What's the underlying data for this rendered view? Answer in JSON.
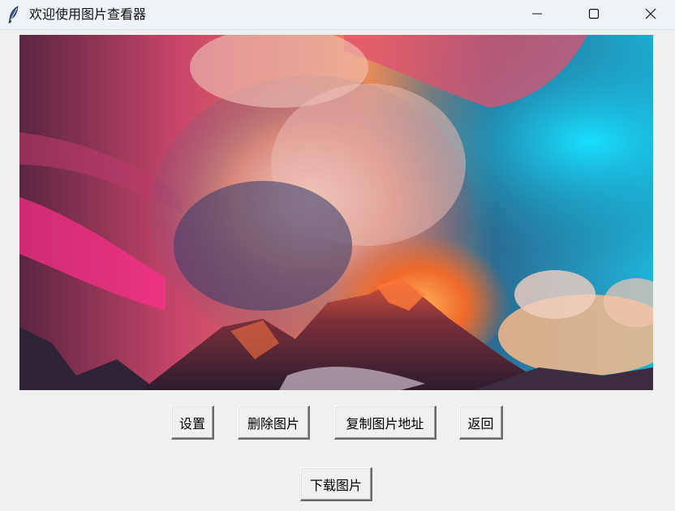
{
  "window": {
    "title": "欢迎使用图片查看器",
    "app_icon": "feather-icon",
    "controls": {
      "minimize": "minimize-icon",
      "maximize": "maximize-icon",
      "close": "close-icon"
    }
  },
  "image": {
    "subject": "volcano-clouds-photo"
  },
  "buttons": {
    "settings": "设置",
    "delete_image": "删除图片",
    "copy_image_path": "复制图片地址",
    "back": "返回",
    "download_image": "下载图片"
  }
}
